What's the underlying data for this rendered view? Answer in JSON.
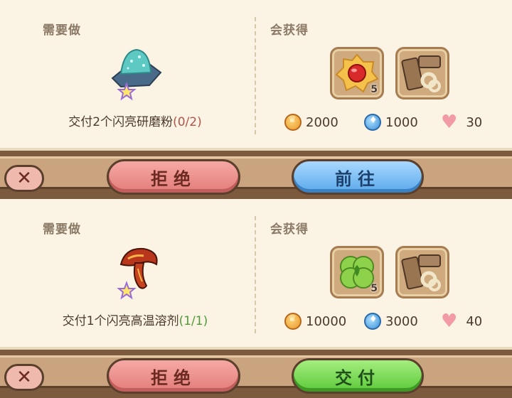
{
  "quests": [
    {
      "need_title": "需要做",
      "reward_title": "会获得",
      "task_prefix": "交付2个闪亮研磨粉",
      "task_progress": "(0/2)",
      "item_icon": "glittery-powder-icon",
      "reward_slots": [
        {
          "icon": "jam-cookie-icon",
          "count": "5"
        },
        {
          "icon": "wood-rope-icon",
          "count": ""
        }
      ],
      "coins": "2000",
      "drops": "1000",
      "hearts": "30",
      "reject_label": "拒绝",
      "action_label": "前往"
    },
    {
      "need_title": "需要做",
      "reward_title": "会获得",
      "task_prefix": "交付1个闪亮高温溶剂",
      "task_progress": "(1/1)",
      "item_icon": "lava-mushroom-icon",
      "reward_slots": [
        {
          "icon": "green-clover-cookie-icon",
          "count": "5"
        },
        {
          "icon": "wood-rope-icon",
          "count": ""
        }
      ],
      "coins": "10000",
      "drops": "3000",
      "hearts": "40",
      "reject_label": "拒绝",
      "action_label": "交付"
    }
  ],
  "colors": {
    "panel_bg": "#fbf3e4",
    "reject_btn": "#e27d7a",
    "go_btn": "#5aa9ea",
    "deliver_btn": "#5cc93a",
    "progress_incomplete": "#b0554a",
    "progress_complete": "#4e9a3a"
  }
}
